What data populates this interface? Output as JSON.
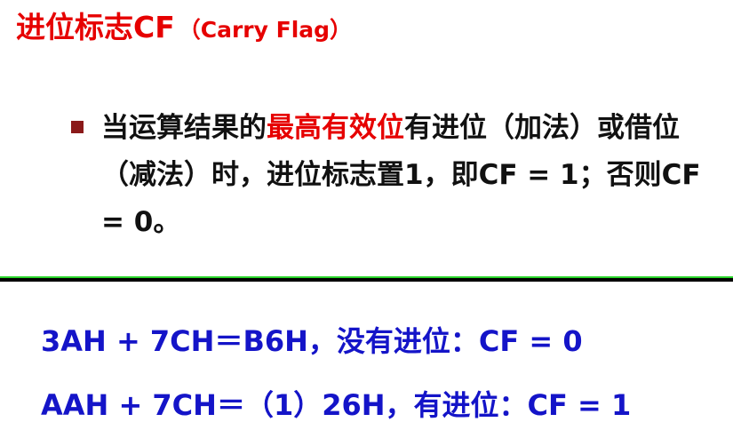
{
  "title": {
    "main": "进位标志CF",
    "sub": "（Carry Flag）"
  },
  "bullet": {
    "text_before": "当运算结果的",
    "highlight": "最高有效位",
    "text_after": "有进位（加法）或借位（减法）时，进位标志置1，即CF = 1；否则CF = 0。"
  },
  "examples": [
    "3AH + 7CH＝B6H，没有进位：CF = 0",
    "AAH + 7CH＝（1）26H，有进位：CF = 1"
  ],
  "colors": {
    "title": "#e60000",
    "highlight": "#e60000",
    "example_text": "#1414c8",
    "bullet_marker": "#8b1a1a",
    "divider_green": "#2ad42a",
    "divider_black": "#000000"
  }
}
